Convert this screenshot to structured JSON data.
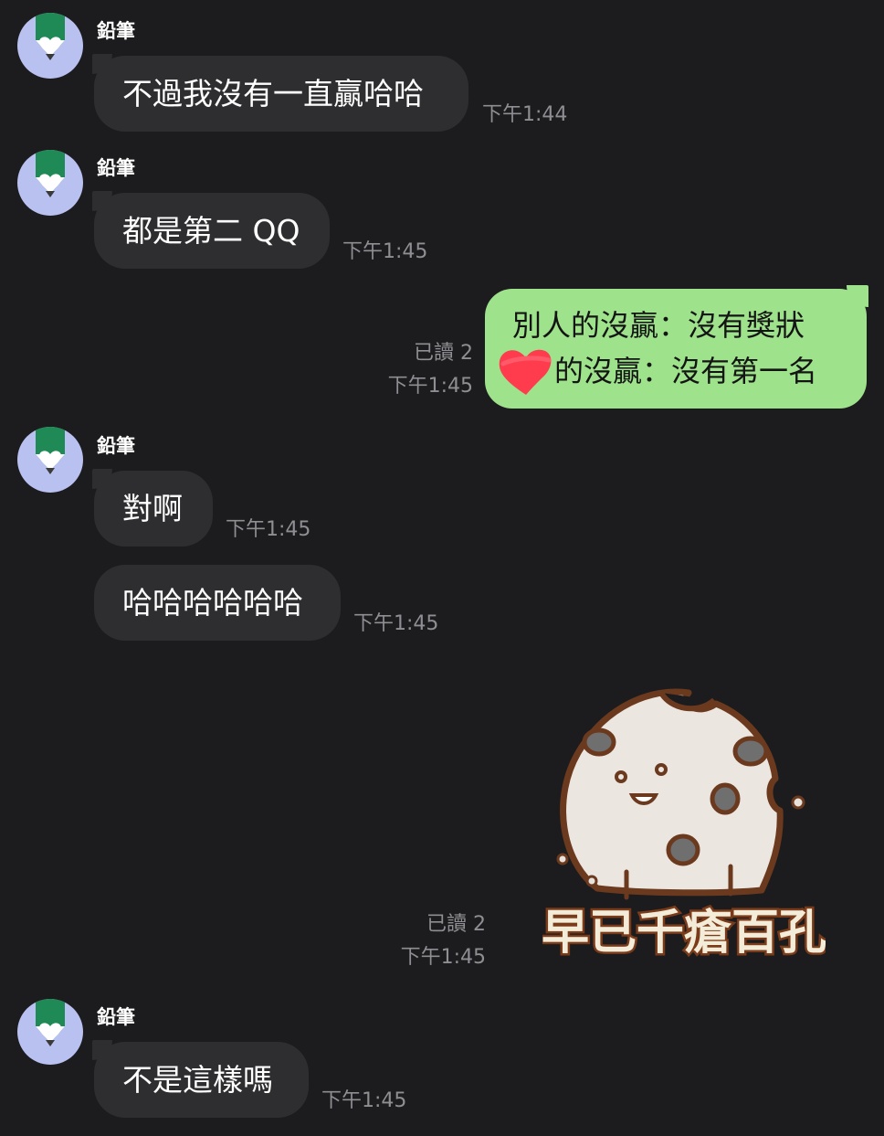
{
  "sender_name": "鉛筆",
  "messages": [
    {
      "text": "不過我沒有一直贏哈哈",
      "time": "下午1:44"
    },
    {
      "text": "都是第二 QQ",
      "time": "下午1:45"
    },
    {
      "line1": "別人的沒贏：沒有獎狀",
      "line2": "的沒贏：沒有第一名",
      "read": "已讀 2",
      "time": "下午1:45"
    },
    {
      "text": "對啊",
      "time": "下午1:45"
    },
    {
      "text": "哈哈哈哈哈哈",
      "time": "下午1:45"
    },
    {
      "sticker_text": "早已千瘡百孔",
      "read": "已讀 2",
      "time": "下午1:45"
    },
    {
      "text": "不是這樣嗎",
      "time": "下午1:45"
    }
  ],
  "colors": {
    "background": "#1c1c1e",
    "incoming_bubble": "#2e2e30",
    "outgoing_bubble": "#9ee38c",
    "avatar_bg": "#b9c1f1",
    "avatar_pencil": "#1f8a55",
    "timestamp": "#8e8e93",
    "redaction": "#ff3b4e"
  },
  "icons": {
    "avatar": "pencil-heart-avatar",
    "redaction": "heart-scribble",
    "sticker": "cookie-character-sticker"
  }
}
